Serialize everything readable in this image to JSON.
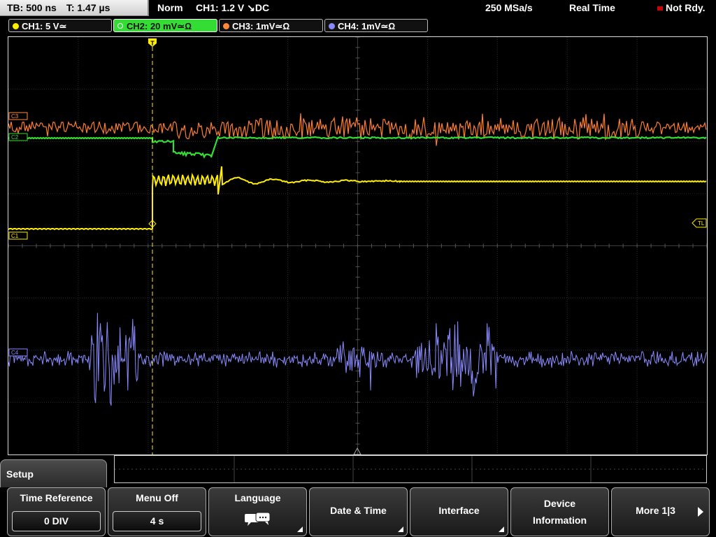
{
  "topbar": {
    "timebase": "TB: 500 ns",
    "trigger_pos": "T: 1.47 µs",
    "trigger_mode": "Norm",
    "trigger_info": "CH1: 1.2 V ↘DC",
    "sample_rate": "250 MSa/s",
    "acq_mode": "Real Time",
    "status": "Not Rdy."
  },
  "channels": [
    {
      "label": "CH1: 5 V≃",
      "color": "#ffee00",
      "active": false
    },
    {
      "label": "CH2: 20 mV≃Ω",
      "color": "#33dd33",
      "active": true
    },
    {
      "label": "CH3: 1mV≃Ω",
      "color": "#ff8a3c",
      "active": false
    },
    {
      "label": "CH4: 1mV≃Ω",
      "color": "#8888ff",
      "active": false
    }
  ],
  "markers": {
    "ch1": "C1",
    "ch2": "C2",
    "ch3": "C3",
    "ch4": "C4",
    "trigger_level": "TL",
    "trigger_top": "T"
  },
  "menu": {
    "title": "Setup",
    "softkeys": [
      {
        "label": "Time Reference",
        "value": "0 DIV"
      },
      {
        "label": "Menu Off",
        "value": "4 s"
      },
      {
        "label": "Language",
        "icon": "speech-bubble-icon"
      },
      {
        "label": "Date & Time"
      },
      {
        "label": "Interface"
      },
      {
        "label": "Device",
        "label2": "Information"
      },
      {
        "label": "More 1|3"
      }
    ]
  }
}
